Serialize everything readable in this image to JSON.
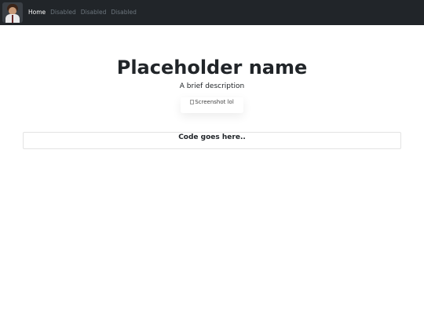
{
  "navbar": {
    "brand_icon": "avatar-photo",
    "links": [
      {
        "label": "Home",
        "state": "active"
      },
      {
        "label": "Disabled",
        "state": "disabled"
      },
      {
        "label": "Disabled",
        "state": "disabled"
      },
      {
        "label": "Disabled",
        "state": "disabled"
      }
    ]
  },
  "hero": {
    "title": "Placeholder name",
    "description": "A brief description",
    "image_alt": "Screenshot lol"
  },
  "code": {
    "text": "Code goes here.."
  },
  "colors": {
    "navbar_bg": "#212529",
    "active_link": "#ffffff",
    "disabled_link": "#6c757d"
  }
}
